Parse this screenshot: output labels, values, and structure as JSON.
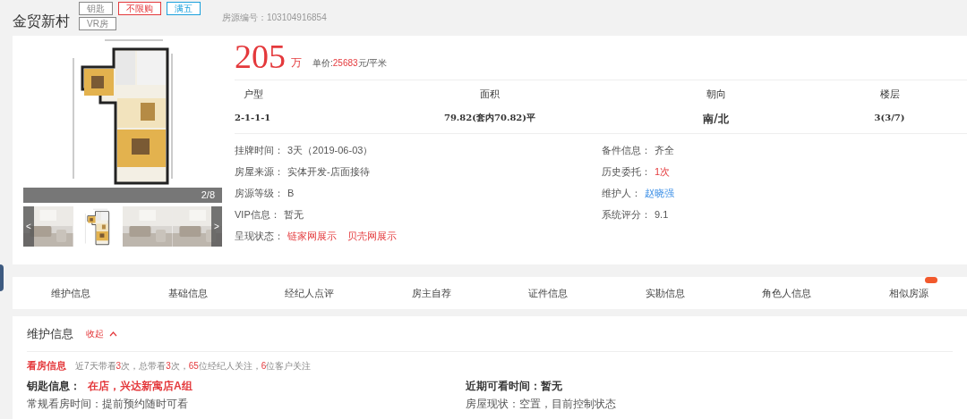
{
  "header": {
    "title": "金贸新村",
    "listing_id": "房源编号：103104916854",
    "tags": [
      {
        "label": "钥匙",
        "color": "#888888"
      },
      {
        "label": "不限购",
        "color": "#e4393c"
      },
      {
        "label": "满五",
        "color": "#1aa0dc"
      },
      {
        "label": "VR房",
        "color": "#888888"
      }
    ]
  },
  "gallery": {
    "counter": "2/8",
    "prev": "<",
    "next": ">",
    "thumbnails": [
      {
        "kind": "picture"
      },
      {
        "kind": "floorplan"
      },
      {
        "kind": "picture"
      },
      {
        "kind": "picture"
      }
    ]
  },
  "price": {
    "total": "205",
    "unit": "万",
    "unit_price_label": "单价:",
    "unit_price": "25683",
    "unit_price_suffix": "元/平米"
  },
  "specs": [
    {
      "label": "户型",
      "value": "2-1-1-1"
    },
    {
      "label": "面积",
      "value": "79.82(套内70.82)平"
    },
    {
      "label": "朝向",
      "value": "南/北"
    },
    {
      "label": "楼层",
      "value": "3(3/7)"
    }
  ],
  "details_left": [
    {
      "label": "挂牌时间：",
      "values": [
        {
          "text": "3天（2019-06-03）",
          "kind": "plain"
        }
      ]
    },
    {
      "label": "房屋来源：",
      "values": [
        {
          "text": "实体开发-店面接待",
          "kind": "plain"
        }
      ]
    },
    {
      "label": "房源等级：",
      "values": [
        {
          "text": "B",
          "kind": "plain"
        }
      ]
    },
    {
      "label": "VIP信息：",
      "values": [
        {
          "text": "暂无",
          "kind": "plain"
        }
      ]
    },
    {
      "label": "呈现状态：",
      "values": [
        {
          "text": "链家网展示",
          "kind": "red"
        },
        {
          "text": "贝壳网展示",
          "kind": "red"
        }
      ]
    }
  ],
  "details_right": [
    {
      "label": "备件信息：",
      "values": [
        {
          "text": "齐全",
          "kind": "plain"
        }
      ]
    },
    {
      "label": "历史委托：",
      "values": [
        {
          "text": "1次",
          "kind": "red"
        }
      ]
    },
    {
      "label": "维护人：",
      "values": [
        {
          "text": "赵晓强",
          "kind": "link"
        }
      ]
    },
    {
      "label": "系统评分：",
      "values": [
        {
          "text": "9.1",
          "kind": "plain"
        }
      ]
    }
  ],
  "tabs": [
    {
      "label": "维护信息",
      "badge": false
    },
    {
      "label": "基础信息",
      "badge": false
    },
    {
      "label": "经纪人点评",
      "badge": false
    },
    {
      "label": "房主自荐",
      "badge": false
    },
    {
      "label": "证件信息",
      "badge": false
    },
    {
      "label": "实勘信息",
      "badge": false
    },
    {
      "label": "角色人信息",
      "badge": false
    },
    {
      "label": "相似房源",
      "badge": true
    }
  ],
  "section": {
    "title": "维护信息",
    "toggle": "收起",
    "expanded": true,
    "viewing": {
      "label": "看房信息",
      "parts": [
        {
          "text": "近7天带看",
          "highlight": false
        },
        {
          "text": "3",
          "highlight": true
        },
        {
          "text": "次，总带看",
          "highlight": false
        },
        {
          "text": "3",
          "highlight": true
        },
        {
          "text": "次，",
          "highlight": false
        },
        {
          "text": "65",
          "highlight": true
        },
        {
          "text": "位经纪人关注，",
          "highlight": false
        },
        {
          "text": "6",
          "highlight": true
        },
        {
          "text": "位客户关注",
          "highlight": false
        }
      ]
    },
    "rows": [
      {
        "left": {
          "label": "钥匙信息：",
          "value": "在店，兴达新寓店A组",
          "kind": "red"
        },
        "right": {
          "label": "近期可看时间：",
          "value": "暂无",
          "kind": "bold"
        }
      },
      {
        "left": {
          "label": "常规看房时间：",
          "value": "提前预约随时可看",
          "kind": "plain"
        },
        "right": {
          "label": "房屋现状：",
          "value": "空置，目前控制状态",
          "kind": "plain"
        }
      }
    ]
  }
}
